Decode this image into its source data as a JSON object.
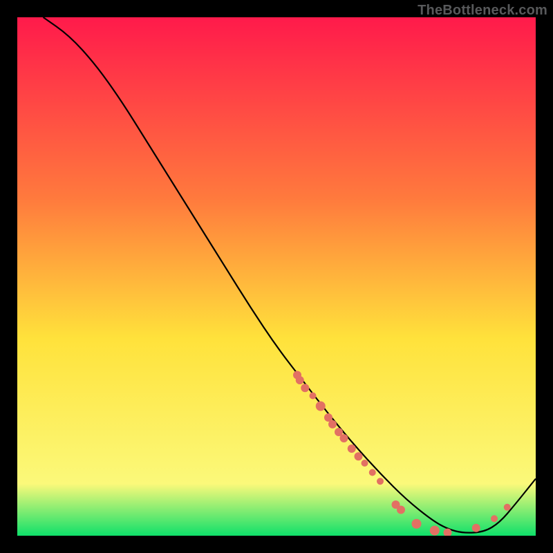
{
  "watermark": "TheBottleneck.com",
  "chart_data": {
    "type": "line",
    "title": "",
    "xlabel": "",
    "ylabel": "",
    "xlim": [
      0,
      100
    ],
    "ylim": [
      0,
      100
    ],
    "background_gradient": {
      "top": "#ff1a4b",
      "mid1": "#ff7a3d",
      "mid2": "#ffe23b",
      "mid3": "#fbf97a",
      "bottom": "#0fe06a"
    },
    "series": [
      {
        "name": "curve",
        "x": [
          5,
          10,
          15,
          20,
          25,
          30,
          35,
          40,
          45,
          50,
          55,
          60,
          65,
          70,
          75,
          80,
          83,
          86,
          90,
          93,
          96,
          100
        ],
        "y": [
          100,
          96.5,
          91,
          84,
          76,
          68,
          60,
          52,
          44,
          36.5,
          30,
          23.5,
          17.5,
          12,
          7,
          3,
          1.3,
          0.5,
          0.7,
          2.5,
          6,
          11
        ],
        "stroke": "#000000"
      }
    ],
    "scatter": [
      {
        "name": "dots",
        "x": 54.0,
        "y": 31.0,
        "r": 6
      },
      {
        "name": "dots",
        "x": 54.5,
        "y": 30.0,
        "r": 6
      },
      {
        "name": "dots",
        "x": 55.5,
        "y": 28.5,
        "r": 6
      },
      {
        "name": "dots",
        "x": 57.0,
        "y": 27.0,
        "r": 5
      },
      {
        "name": "dots",
        "x": 58.5,
        "y": 25.0,
        "r": 7
      },
      {
        "name": "dots",
        "x": 60.0,
        "y": 22.8,
        "r": 6
      },
      {
        "name": "dots",
        "x": 60.8,
        "y": 21.5,
        "r": 6
      },
      {
        "name": "dots",
        "x": 62.0,
        "y": 20.0,
        "r": 6
      },
      {
        "name": "dots",
        "x": 63.0,
        "y": 18.8,
        "r": 6
      },
      {
        "name": "dots",
        "x": 64.5,
        "y": 16.8,
        "r": 6
      },
      {
        "name": "dots",
        "x": 65.8,
        "y": 15.3,
        "r": 6
      },
      {
        "name": "dots",
        "x": 67.0,
        "y": 14.0,
        "r": 5
      },
      {
        "name": "dots",
        "x": 68.5,
        "y": 12.2,
        "r": 5
      },
      {
        "name": "dots",
        "x": 70.0,
        "y": 10.5,
        "r": 5
      },
      {
        "name": "dots",
        "x": 73.0,
        "y": 6.0,
        "r": 6
      },
      {
        "name": "dots",
        "x": 74.0,
        "y": 5.0,
        "r": 6
      },
      {
        "name": "dots",
        "x": 77.0,
        "y": 2.3,
        "r": 7
      },
      {
        "name": "dots",
        "x": 80.5,
        "y": 1.0,
        "r": 7
      },
      {
        "name": "dots",
        "x": 83.0,
        "y": 0.6,
        "r": 6
      },
      {
        "name": "dots",
        "x": 88.5,
        "y": 1.5,
        "r": 6
      },
      {
        "name": "dots",
        "x": 92.0,
        "y": 3.3,
        "r": 5
      },
      {
        "name": "dots",
        "x": 94.5,
        "y": 5.5,
        "r": 5
      }
    ],
    "dot_color": "#e27063"
  }
}
